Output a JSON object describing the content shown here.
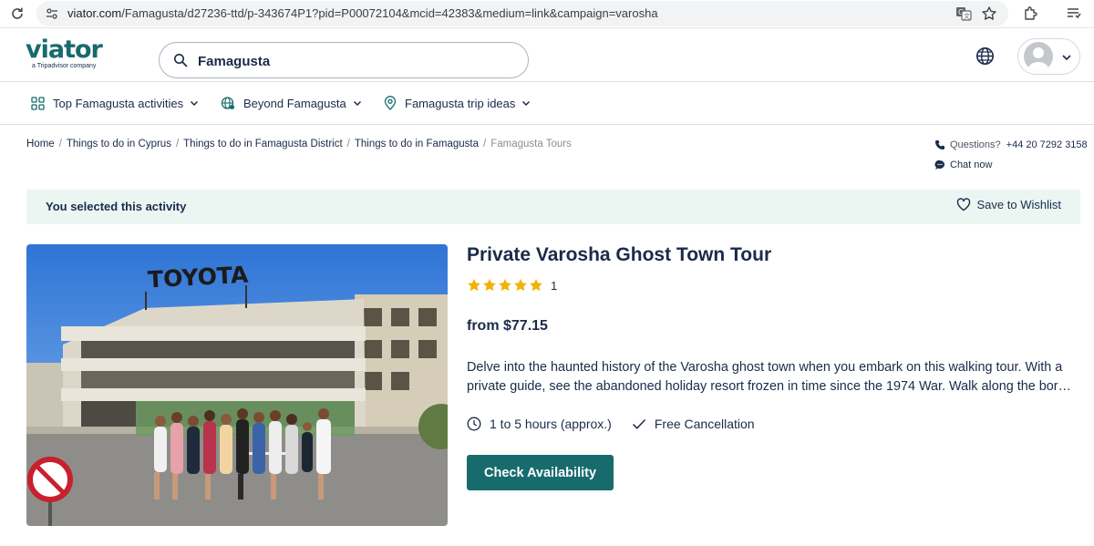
{
  "browser": {
    "url_host": "viator.com",
    "url_path": "/Famagusta/d27236-ttd/p-343674P1?pid=P00072104&mcid=42383&medium=link&campaign=varosha",
    "icons": [
      "reload-icon",
      "site-info-icon",
      "translate-icon",
      "bookmark-star-icon",
      "extensions-icon",
      "reading-list-icon"
    ]
  },
  "header": {
    "logo_text": "viator",
    "logo_tagline": "a Tripadvisor company",
    "search_value": "Famagusta",
    "brand_color": "#186b6d"
  },
  "nav": {
    "items": [
      {
        "label": "Top Famagusta activities",
        "icon": "grid-icon"
      },
      {
        "label": "Beyond Famagusta",
        "icon": "globe-pin-icon"
      },
      {
        "label": "Famagusta trip ideas",
        "icon": "map-pin-icon"
      }
    ]
  },
  "breadcrumb": {
    "items": [
      "Home",
      "Things to do in Cyprus",
      "Things to do in Famagusta District",
      "Things to do in Famagusta"
    ],
    "current": "Famagusta Tours"
  },
  "contact": {
    "questions_label": "Questions?",
    "phone": "+44 20 7292 3158",
    "chat_label": "Chat now"
  },
  "banner": {
    "text": "You selected this activity",
    "wishlist_label": "Save to Wishlist",
    "background": "#ebf6f3"
  },
  "photo": {
    "sign_text": "TOYOTA"
  },
  "product": {
    "title": "Private Varosha Ghost Town Tour",
    "rating_stars": 5,
    "review_count": "1",
    "price": "from $77.15",
    "description_lines": [
      "Delve into the haunted history of the Varosha ghost town when you embark on this walking tour. With a",
      "private guide, see the abandoned holiday resort frozen in time since the 1974 War. Walk along the border..."
    ],
    "duration": "1 to 5 hours (approx.)",
    "cancellation": "Free Cancellation",
    "cta_label": "Check Availability",
    "star_color": "#f2b203"
  }
}
